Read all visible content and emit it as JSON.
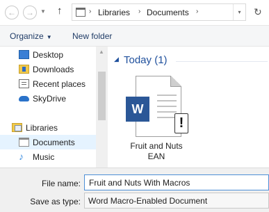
{
  "navigation": {
    "back_glyph": "←",
    "forward_glyph": "→",
    "recent_glyph": "▼",
    "up_glyph": "↑",
    "refresh_glyph": "↻"
  },
  "address_bar": {
    "separator": "›",
    "crumbs": [
      "Libraries",
      "Documents"
    ],
    "dropdown_glyph": "▾"
  },
  "toolbar": {
    "organize_label": "Organize",
    "organize_caret": "▼",
    "new_folder_label": "New folder"
  },
  "sidebar": {
    "items": [
      {
        "label": "Desktop",
        "icon": "desktop-icon"
      },
      {
        "label": "Downloads",
        "icon": "downloads-icon"
      },
      {
        "label": "Recent places",
        "icon": "recent-places-icon"
      },
      {
        "label": "SkyDrive",
        "icon": "skydrive-icon"
      },
      {
        "label": "Libraries",
        "icon": "libraries-icon"
      },
      {
        "label": "Documents",
        "icon": "documents-icon",
        "selected": true
      },
      {
        "label": "Music",
        "icon": "music-icon"
      }
    ],
    "music_glyph": "♪",
    "scroll_up_glyph": "▲"
  },
  "content": {
    "group_chevron": "◢",
    "group_title": "Today (1)",
    "files": [
      {
        "name": "Fruit and Nuts EAN",
        "icon": "word-macro-document-icon",
        "badge": "W",
        "warning": "!"
      }
    ]
  },
  "save_form": {
    "file_name_label": "File name:",
    "file_name_value": "Fruit and Nuts With Macros",
    "save_as_type_label": "Save as type:",
    "save_as_type_value": "Word Macro-Enabled Document"
  },
  "colors": {
    "accent": "#1e4f9c",
    "selection": "#e5f3ff",
    "word_blue": "#2b5797",
    "input_focus_border": "#4d8fd6"
  }
}
